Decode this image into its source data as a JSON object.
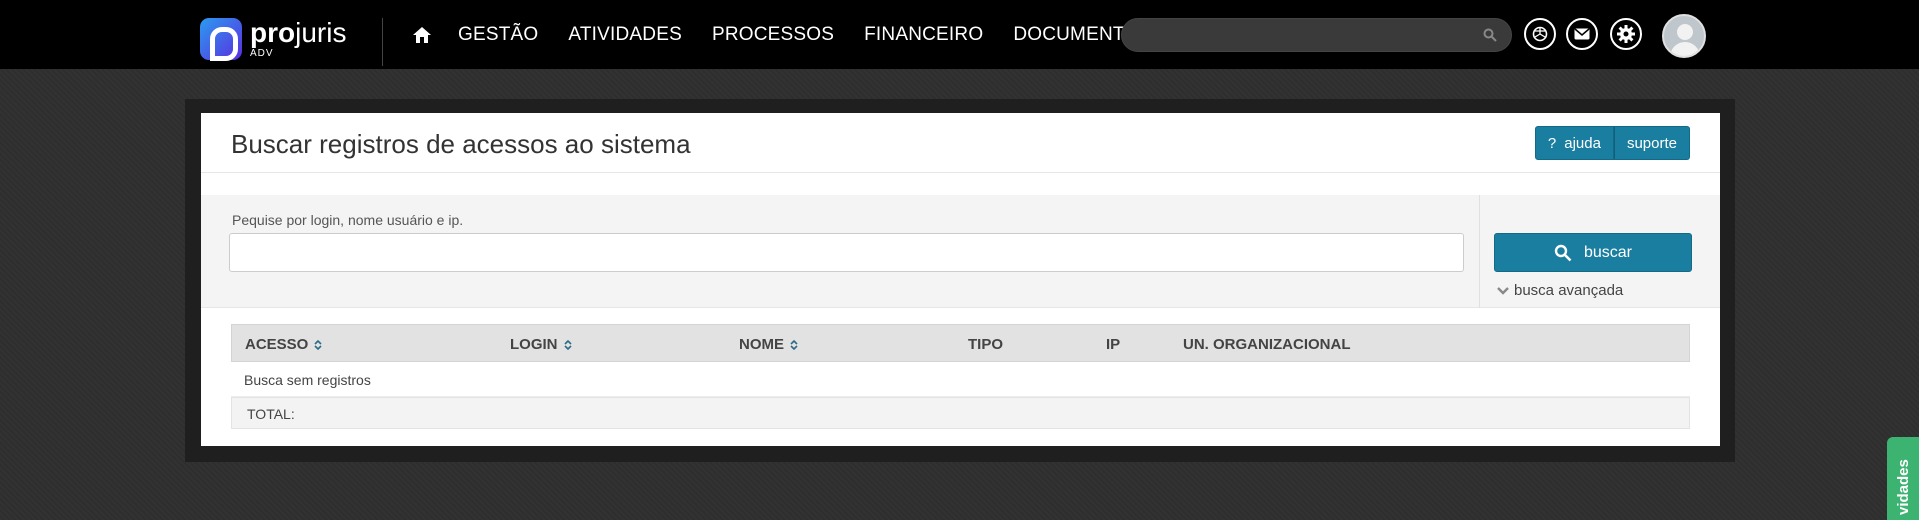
{
  "brand": {
    "name_bold": "pro",
    "name_light": "juris",
    "sub": "ADV"
  },
  "nav": {
    "items": [
      "GESTÃO",
      "ATIVIDADES",
      "PROCESSOS",
      "FINANCEIRO",
      "DOCUMENTOS"
    ]
  },
  "search": {
    "placeholder": "",
    "value": ""
  },
  "page": {
    "title": "Buscar registros de acessos ao sistema",
    "help_label": "ajuda",
    "support_label": "suporte"
  },
  "filter": {
    "label": "Pequise por login, nome usuário e ip.",
    "input_value": "",
    "search_button": "buscar",
    "advanced_label": "busca avançada"
  },
  "table": {
    "columns": [
      "ACESSO",
      "LOGIN",
      "NOME",
      "TIPO",
      "IP",
      "UN. ORGANIZACIONAL"
    ],
    "empty_message": "Busca sem registros",
    "total_label": "TOTAL:"
  },
  "side_tab": {
    "label": "vidades"
  },
  "colors": {
    "accent": "#1a7ea0",
    "topbar": "#000000",
    "side_tab": "#3cb371"
  }
}
